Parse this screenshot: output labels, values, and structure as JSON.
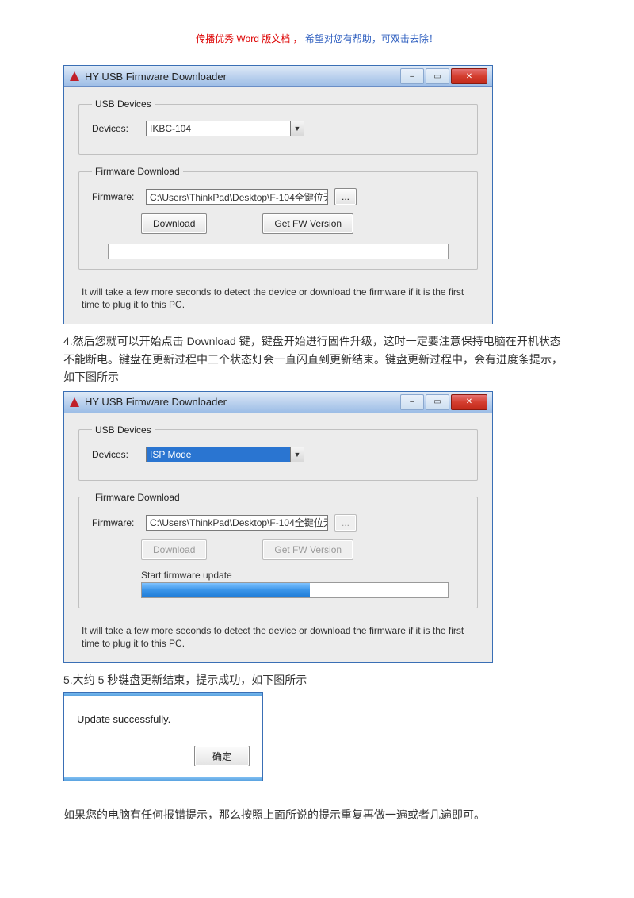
{
  "header": {
    "line_part1": "传播优秀 Word 版文档 ，",
    "line_part2": "希望对您有帮助，可双击去除！"
  },
  "app_title": "HY USB Firmware Downloader",
  "window_controls": {
    "minimize": "–",
    "maximize": "▭",
    "close": "✕"
  },
  "groups": {
    "usb_devices": "USB Devices",
    "firmware_download": "Firmware Download"
  },
  "labels": {
    "devices": "Devices:",
    "firmware": "Firmware:"
  },
  "buttons": {
    "download": "Download",
    "get_fw_version": "Get FW Version",
    "browse": "...",
    "ok": "确定"
  },
  "screenshot1": {
    "device_value": "IKBC-104",
    "firmware_path": "C:\\Users\\ThinkPad\\Desktop\\F-104全键位无",
    "progress_percent": 0,
    "status_text": ""
  },
  "screenshot2": {
    "device_value": "ISP Mode",
    "firmware_path": "C:\\Users\\ThinkPad\\Desktop\\F-104全键位无",
    "status_text": "Start firmware update",
    "progress_percent": 55
  },
  "info_text": "It will take a few more seconds to detect the device or download the firmware if it is the first time to plug it to this PC.",
  "paragraphs": {
    "p4": "4.然后您就可以开始点击 Download 键，键盘开始进行固件升级，这时一定要注意保持电脑在开机状态不能断电。键盘在更新过程中三个状态灯会一直闪直到更新结束。键盘更新过程中，会有进度条提示，如下图所示",
    "p5": "5.大约 5 秒键盘更新结束，提示成功，如下图所示",
    "p6": "如果您的电脑有任何报错提示，那么按照上面所说的提示重复再做一遍或者几遍即可。"
  },
  "dialog": {
    "message": "Update successfully."
  }
}
